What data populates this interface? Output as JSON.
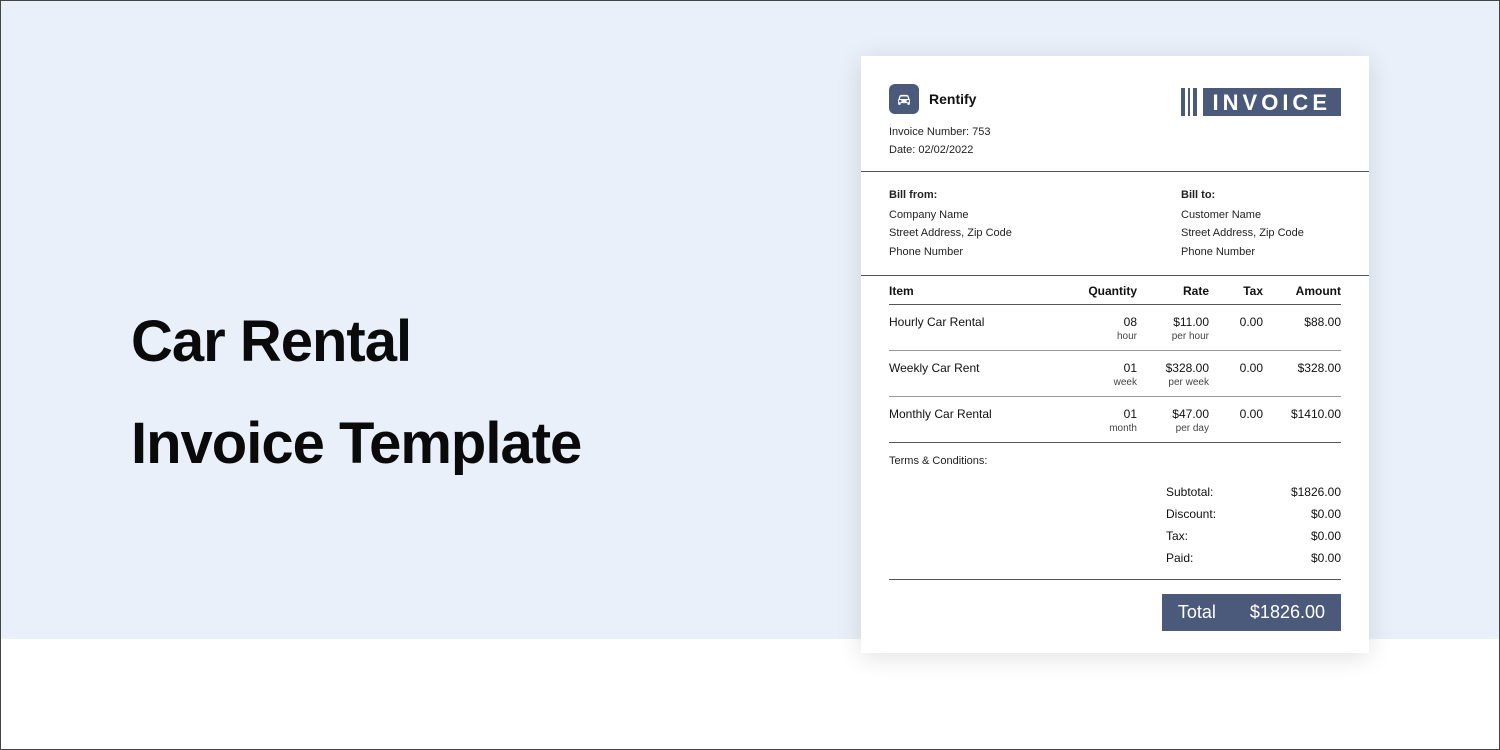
{
  "heading": {
    "line1": "Car Rental",
    "line2": "Invoice Template"
  },
  "brand": {
    "name": "Rentify"
  },
  "meta": {
    "invoice_number_label": "Invoice Number:",
    "invoice_number": "753",
    "date_label": "Date:",
    "date": "02/02/2022"
  },
  "badge": {
    "text": "INVOICE"
  },
  "bill_from": {
    "label": "Bill from:",
    "name": "Company Name",
    "address": "Street Address, Zip Code",
    "phone": "Phone Number"
  },
  "bill_to": {
    "label": "Bill to:",
    "name": "Customer Name",
    "address": "Street Address, Zip Code",
    "phone": "Phone Number"
  },
  "table": {
    "headers": {
      "item": "Item",
      "qty": "Quantity",
      "rate": "Rate",
      "tax": "Tax",
      "amount": "Amount"
    },
    "rows": [
      {
        "item": "Hourly Car Rental",
        "qty": "08",
        "qty_unit": "hour",
        "rate": "$11.00",
        "rate_unit": "per hour",
        "tax": "0.00",
        "amount": "$88.00"
      },
      {
        "item": "Weekly Car Rent",
        "qty": "01",
        "qty_unit": "week",
        "rate": "$328.00",
        "rate_unit": "per week",
        "tax": "0.00",
        "amount": "$328.00"
      },
      {
        "item": "Monthly Car Rental",
        "qty": "01",
        "qty_unit": "month",
        "rate": "$47.00",
        "rate_unit": "per day",
        "tax": "0.00",
        "amount": "$1410.00"
      }
    ]
  },
  "terms": {
    "label": "Terms & Conditions:"
  },
  "totals": {
    "subtotal_label": "Subtotal:",
    "subtotal": "$1826.00",
    "discount_label": "Discount:",
    "discount": "$0.00",
    "tax_label": "Tax:",
    "tax": "$0.00",
    "paid_label": "Paid:",
    "paid": "$0.00"
  },
  "grand": {
    "label": "Total",
    "value": "$1826.00"
  }
}
